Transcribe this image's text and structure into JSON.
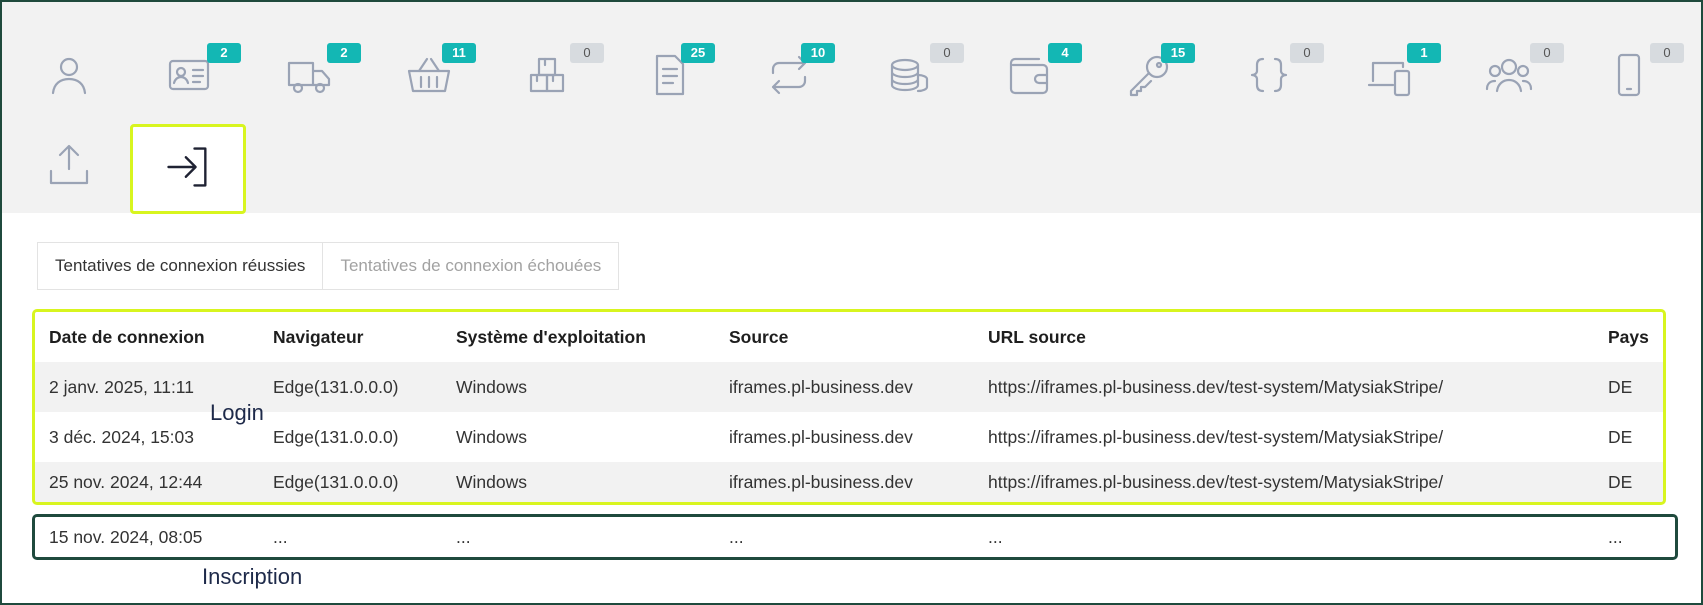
{
  "colors": {
    "highlight": "#d8f51f",
    "frame": "#1f4a3d",
    "badge": "#13b7b4",
    "badge_zero": "#d7dbdf",
    "icon": "#9aa3b5"
  },
  "icon_tabs": [
    {
      "icon": "user-icon",
      "badge": null
    },
    {
      "icon": "id-card-icon",
      "badge": "2"
    },
    {
      "icon": "truck-icon",
      "badge": "2"
    },
    {
      "icon": "basket-icon",
      "badge": "11"
    },
    {
      "icon": "boxes-icon",
      "badge": "0"
    },
    {
      "icon": "document-icon",
      "badge": "25"
    },
    {
      "icon": "repeat-icon",
      "badge": "10"
    },
    {
      "icon": "coins-icon",
      "badge": "0"
    },
    {
      "icon": "wallet-icon",
      "badge": "4"
    },
    {
      "icon": "key-icon",
      "badge": "15"
    },
    {
      "icon": "braces-icon",
      "badge": "0"
    },
    {
      "icon": "devices-icon",
      "badge": "1"
    },
    {
      "icon": "users-icon",
      "badge": "0"
    },
    {
      "icon": "smartphone-icon",
      "badge": "0"
    },
    {
      "icon": "upload-icon",
      "badge": null
    },
    {
      "icon": "login-icon",
      "badge": null,
      "active": true
    }
  ],
  "subtabs": {
    "success": "Tentatives de connexion réussies",
    "failed": "Tentatives de connexion échouées"
  },
  "table": {
    "headers": [
      "Date de connexion",
      "Navigateur",
      "Système d'exploitation",
      "Source",
      "URL source",
      "Pays"
    ],
    "rows": [
      [
        "2 janv. 2025, 11:11",
        "Edge(131.0.0.0)",
        "Windows",
        "iframes.pl-business.dev",
        "https://iframes.pl-business.dev/test-system/MatysiakStripe/",
        "DE"
      ],
      [
        "3 déc. 2024, 15:03",
        "Edge(131.0.0.0)",
        "Windows",
        "iframes.pl-business.dev",
        "https://iframes.pl-business.dev/test-system/MatysiakStripe/",
        "DE"
      ],
      [
        "25 nov. 2024, 12:44",
        "Edge(131.0.0.0)",
        "Windows",
        "iframes.pl-business.dev",
        "https://iframes.pl-business.dev/test-system/MatysiakStripe/",
        "DE"
      ]
    ],
    "registration_row": [
      "15 nov. 2024, 08:05",
      "...",
      "...",
      "...",
      "...",
      "..."
    ]
  },
  "annotations": {
    "login": "Login",
    "registration": "Inscription"
  }
}
